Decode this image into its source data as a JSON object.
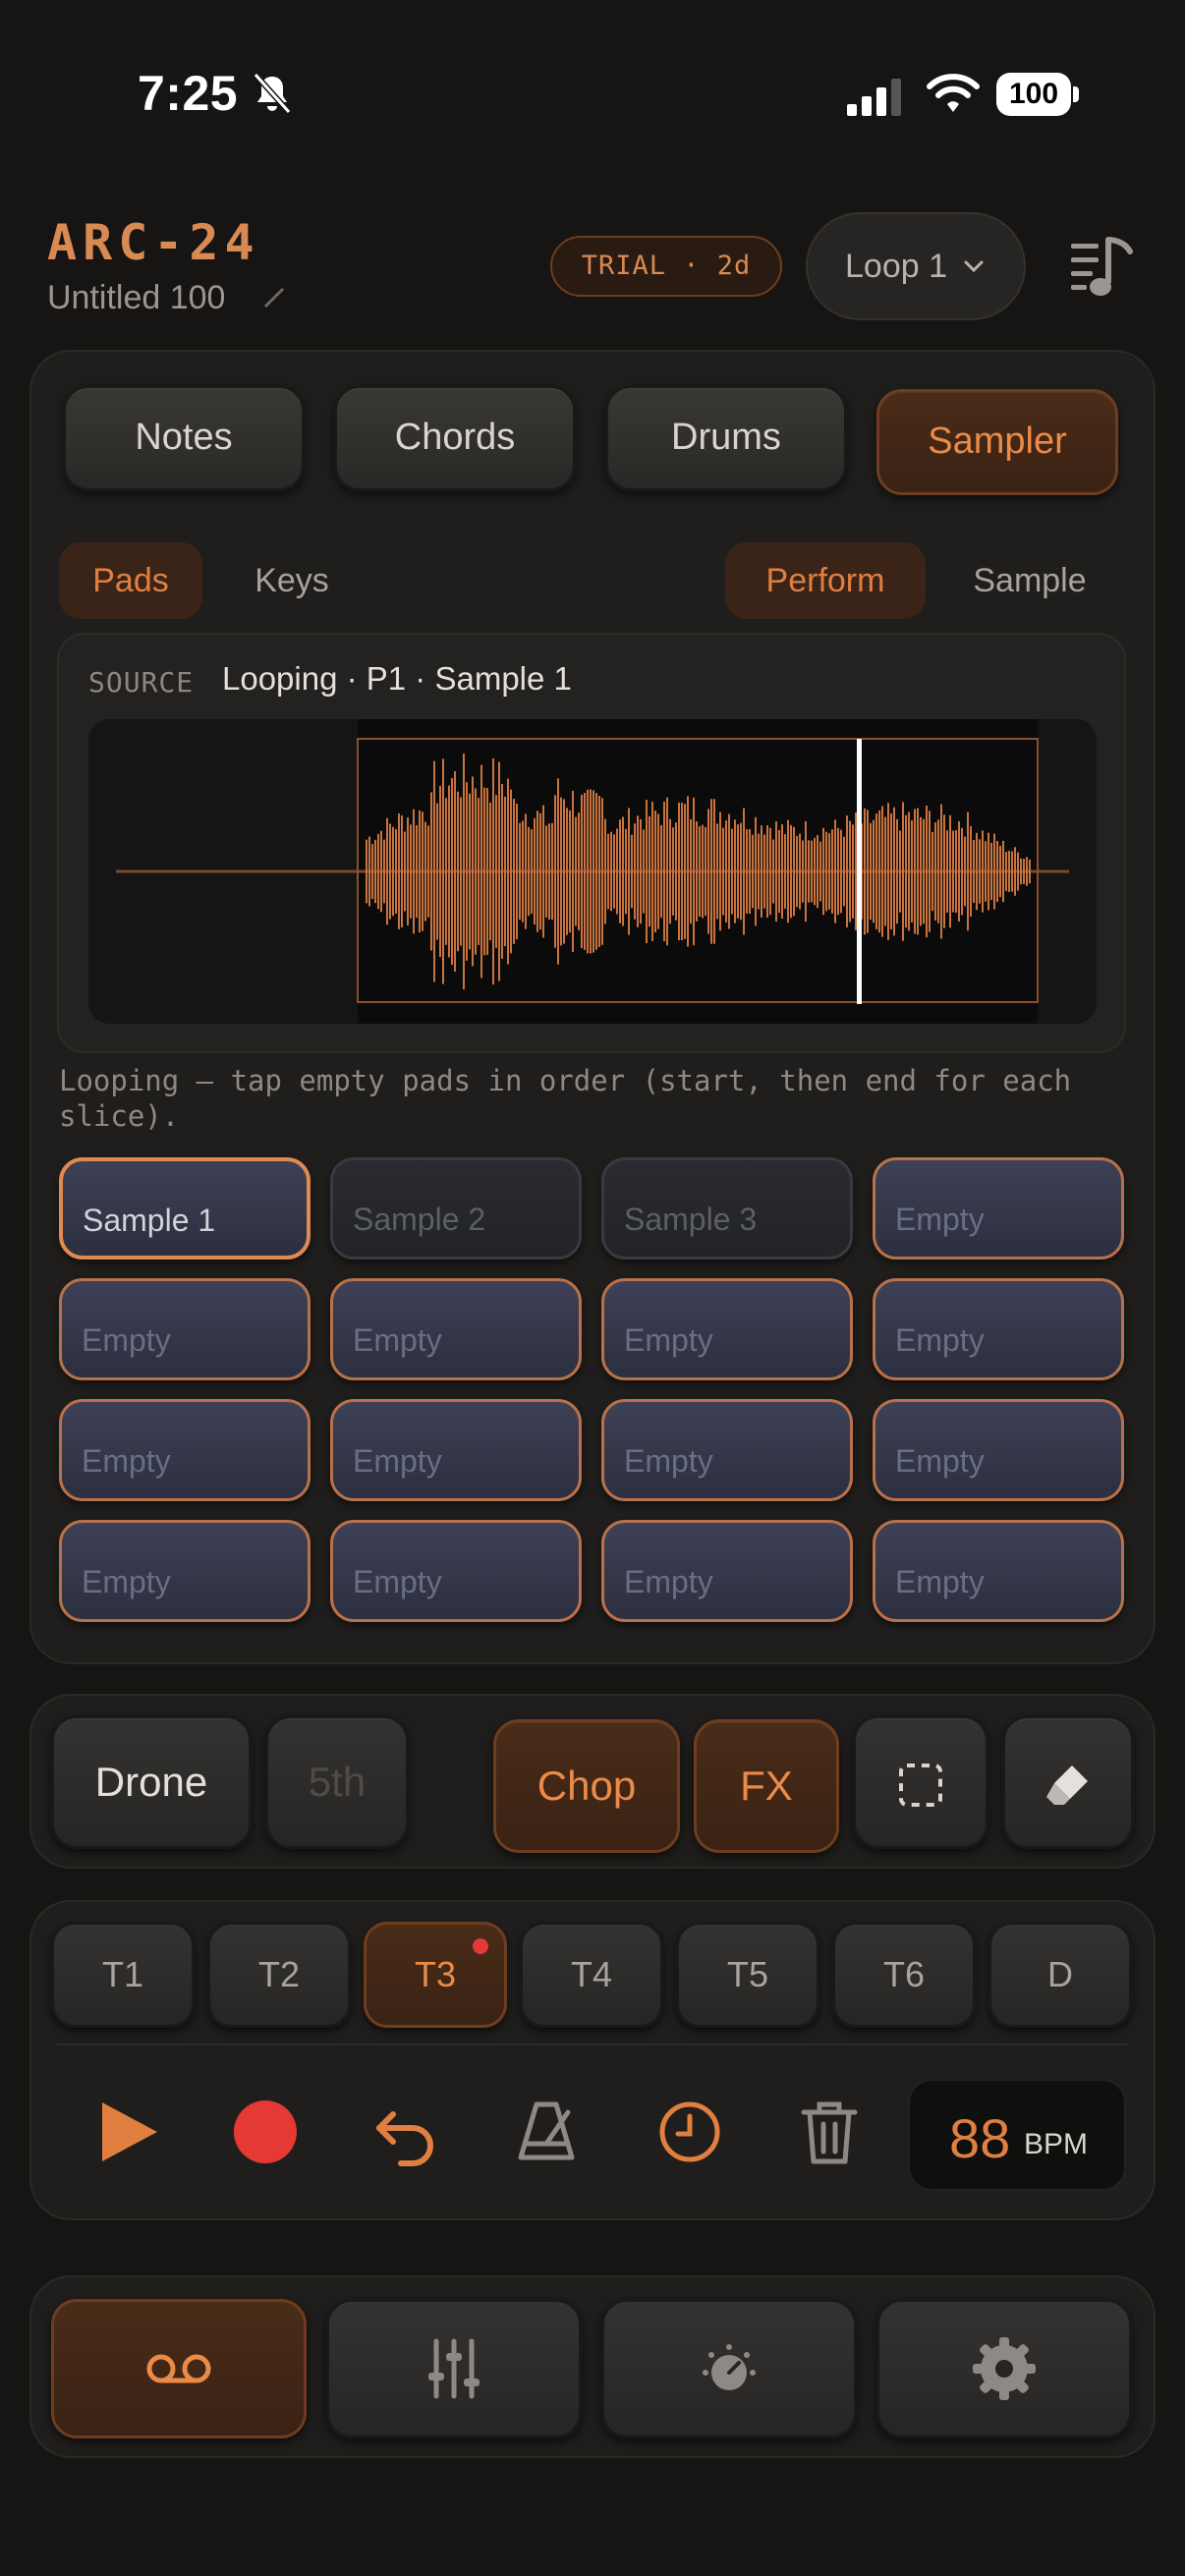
{
  "status_bar": {
    "time": "7:25",
    "battery": "100"
  },
  "header": {
    "app_title": "ARC-24",
    "project_name": "Untitled 100",
    "trial_badge": "TRIAL · 2d",
    "loop_select": "Loop 1"
  },
  "mode_tabs": [
    {
      "label": "Notes",
      "active": false
    },
    {
      "label": "Chords",
      "active": false
    },
    {
      "label": "Drums",
      "active": false
    },
    {
      "label": "Sampler",
      "active": true
    }
  ],
  "sub_tabs": {
    "pads": "Pads",
    "keys": "Keys",
    "perform": "Perform",
    "sample": "Sample"
  },
  "source": {
    "label": "SOURCE",
    "value": "Looping · P1 · Sample 1"
  },
  "hint": "Looping — tap empty pads in order (start, then end for each slice).",
  "pads": [
    "Sample 1",
    "Sample 2",
    "Sample 3",
    "Empty",
    "Empty",
    "Empty",
    "Empty",
    "Empty",
    "Empty",
    "Empty",
    "Empty",
    "Empty",
    "Empty",
    "Empty",
    "Empty",
    "Empty"
  ],
  "tools": {
    "drone": "Drone",
    "fifth": "5th",
    "chop": "Chop",
    "fx": "FX"
  },
  "tracks": [
    "T1",
    "T2",
    "T3",
    "T4",
    "T5",
    "T6",
    "D"
  ],
  "transport": {
    "bpm": "88",
    "bpm_unit": "BPM"
  },
  "colors": {
    "accent": "#e07f40",
    "record": "#e53935",
    "background": "#161514"
  },
  "nav_icons": [
    "tape-icon",
    "mixer-icon",
    "knob-icon",
    "gear-icon"
  ]
}
